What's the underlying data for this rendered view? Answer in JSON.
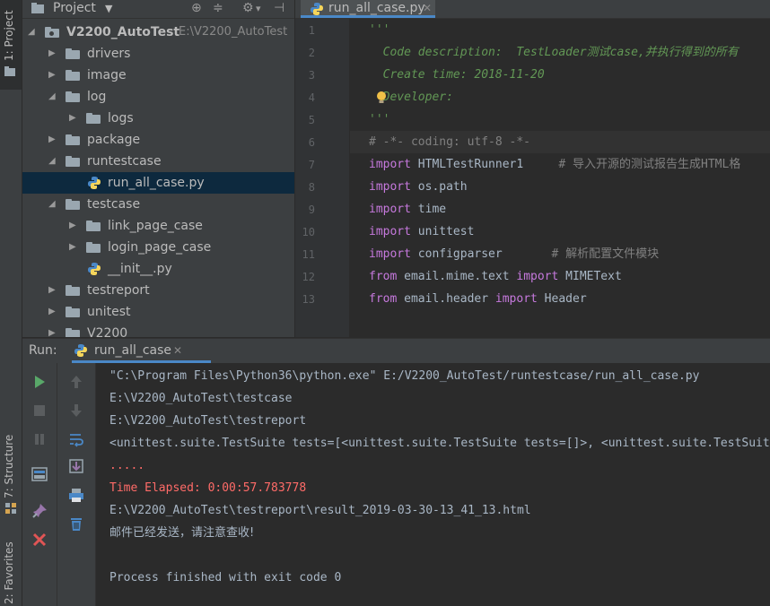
{
  "left_strip": {
    "project_tab": "1: Project",
    "structure_tab": "7: Structure",
    "favorites_tab": "2: Favorites"
  },
  "project_panel": {
    "title": "Project",
    "root": {
      "name": "V2200_AutoTest",
      "path": "E:\\V2200_AutoTest"
    },
    "items": [
      {
        "label": "drivers"
      },
      {
        "label": "image"
      },
      {
        "label": "log"
      },
      {
        "label": "logs"
      },
      {
        "label": "package"
      },
      {
        "label": "runtestcase"
      },
      {
        "label": "run_all_case.py"
      },
      {
        "label": "testcase"
      },
      {
        "label": "link_page_case"
      },
      {
        "label": "login_page_case"
      },
      {
        "label": "__init__.py"
      },
      {
        "label": "testreport"
      },
      {
        "label": "unitest"
      },
      {
        "label": "V2200"
      }
    ]
  },
  "editor": {
    "tab_label": "run_all_case.py",
    "line_numbers": [
      "1",
      "2",
      "3",
      "4",
      "5",
      "6",
      "7",
      "8",
      "9",
      "10",
      "11",
      "12",
      "13"
    ],
    "lines": {
      "l1": "'''",
      "l2": "  Code description:  TestLoader测试case,并执行得到的所有",
      "l3": "  Create time: 2018-11-20",
      "l4": "  Developer:",
      "l5": "'''",
      "l6": "# -*- coding: utf-8 -*-",
      "l7_kw": "import",
      "l7_mod": " HTMLTestRunner1     ",
      "l7_cmt": "# 导入开源的测试报告生成HTML格",
      "l8_kw": "import",
      "l8_mod": " os.path",
      "l9_kw": "import",
      "l9_mod": " time",
      "l10_kw": "import",
      "l10_mod": " unittest",
      "l11_kw": "import",
      "l11_mod": " configparser       ",
      "l11_cmt": "# 解析配置文件模块",
      "l12_kw": "from",
      "l12_mod": " email.mime.text ",
      "l12_kw2": "import",
      "l12_mod2": " MIMEText",
      "l13_kw": "from",
      "l13_mod": " email.header ",
      "l13_kw2": "import",
      "l13_mod2": " Header"
    }
  },
  "run_panel": {
    "label": "Run:",
    "tab_label": "run_all_case",
    "console": [
      "\"C:\\Program Files\\Python36\\python.exe\" E:/V2200_AutoTest/runtestcase/run_all_case.py",
      "E:\\V2200_AutoTest\\testcase",
      "E:\\V2200_AutoTest\\testreport",
      "<unittest.suite.TestSuite tests=[<unittest.suite.TestSuite tests=[]>, <unittest.suite.TestSuite",
      ".....",
      "Time Elapsed: 0:00:57.783778",
      "E:\\V2200_AutoTest\\testreport\\result_2019-03-30-13_41_13.html",
      "邮件已经发送，请注意查收!",
      "",
      "Process finished with exit code 0"
    ]
  },
  "colors": {
    "selection": "#0d293e",
    "tab_underline": "#4a88c7",
    "keyword": "#cc7832",
    "docstring": "#629755",
    "error_text": "#ff6b68"
  }
}
